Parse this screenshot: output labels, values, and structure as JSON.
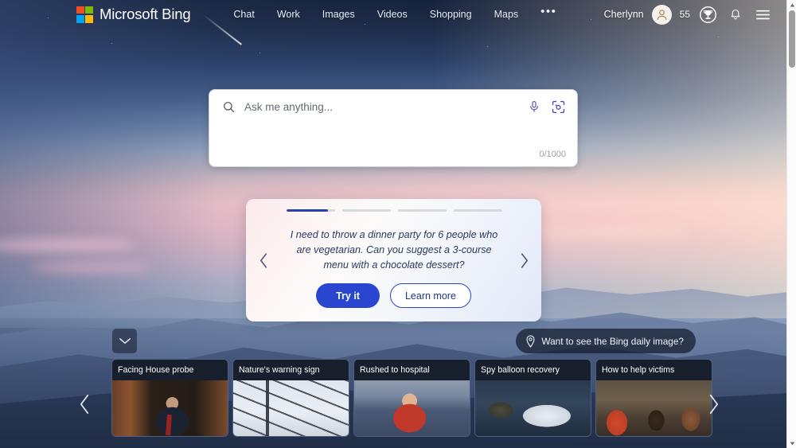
{
  "brand": {
    "logo_text": "Microsoft Bing",
    "logo_icon": "microsoft-squares-logo",
    "logo_colors": [
      "#f25022",
      "#7fba00",
      "#00a4ef",
      "#ffb900"
    ]
  },
  "nav": {
    "links": [
      {
        "label": "Chat",
        "name": "nav-link-chat"
      },
      {
        "label": "Work",
        "name": "nav-link-work"
      },
      {
        "label": "Images",
        "name": "nav-link-images"
      },
      {
        "label": "Videos",
        "name": "nav-link-videos"
      },
      {
        "label": "Shopping",
        "name": "nav-link-shopping"
      },
      {
        "label": "Maps",
        "name": "nav-link-maps"
      }
    ],
    "more_label": "•••",
    "more_icon": "ellipsis-icon"
  },
  "account": {
    "user_name": "Cherlynn",
    "avatar_icon": "person-avatar-icon",
    "rewards_points": "55",
    "rewards_icon": "rewards-trophy-icon",
    "notifications_icon": "bell-icon",
    "menu_icon": "hamburger-menu-icon"
  },
  "search": {
    "placeholder": "Ask me anything...",
    "value": "",
    "search_icon": "search-icon",
    "mic_icon": "microphone-icon",
    "lens_icon": "visual-search-camera-icon",
    "char_count": "0/1000"
  },
  "suggestion_card": {
    "prompt": "I need to throw a dinner party for 6 people who are vegetarian. Can you suggest a 3-course menu with a chocolate dessert?",
    "try_label": "Try it",
    "learn_label": "Learn more",
    "prev_icon": "chevron-left-icon",
    "next_icon": "chevron-right-icon",
    "progress": {
      "total": 4,
      "active_index": 0,
      "active_fill_percent": 85,
      "active_color": "#2b3fad",
      "track_color": "#d8d9dd"
    }
  },
  "overlay_controls": {
    "collapse_icon": "chevron-down-icon",
    "daily_image_label": "Want to see the Bing daily image?",
    "daily_image_icon": "location-pin-icon"
  },
  "news_carousel": {
    "prev_icon": "chevron-left-icon",
    "next_icon": "chevron-right-icon",
    "cards": [
      {
        "title": "Facing House probe",
        "thumb_class": "th-hearing"
      },
      {
        "title": "Nature's warning sign",
        "thumb_class": "th-wires"
      },
      {
        "title": "Rushed to hospital",
        "thumb_class": "th-stadium"
      },
      {
        "title": "Spy balloon recovery",
        "thumb_class": "th-balloon"
      },
      {
        "title": "How to help victims",
        "thumb_class": "th-crowd"
      }
    ]
  },
  "scrollbar": {
    "up_icon": "scroll-up-arrow-icon",
    "down_icon": "scroll-down-arrow-icon",
    "thumb_name": "scrollbar-thumb"
  }
}
